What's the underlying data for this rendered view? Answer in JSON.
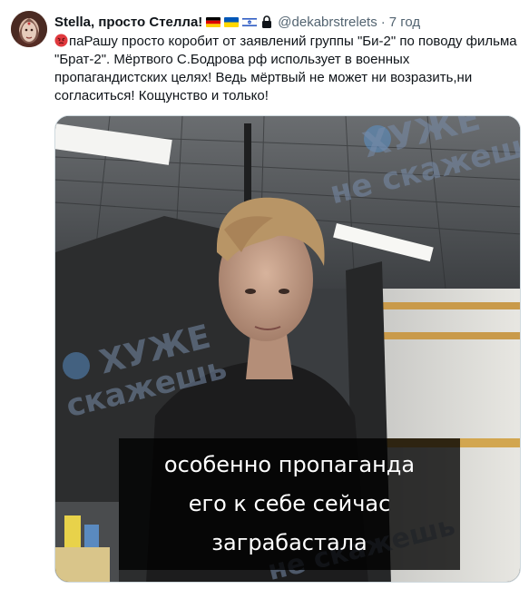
{
  "tweet": {
    "display_name": "Stella, просто Стелла!",
    "handle": "@dekabrstrelets",
    "separator": "·",
    "time": "7 год",
    "flags": [
      "flag-germany",
      "flag-ukraine",
      "flag-israel"
    ],
    "text_after_emoji": "паРашу просто коробит от заявлений группы \"Би-2\" по поводу фильма \"Брат-2\". Мёртвого С.Бодрова рф использует в военных пропагандистских целях! Ведь мёртвый не может ни возразить,ни согласиться! Кощунство и только!"
  },
  "media": {
    "subtitle_lines": [
      "особенно пропаганда",
      "его к себе сейчас",
      "заграбастала"
    ],
    "watermark": {
      "line1": "ХУЖЕ",
      "line2": "не скажешь",
      "line2_alt": "скажешь"
    }
  },
  "colors": {
    "text": "#0f1419",
    "secondary": "#536471",
    "border": "#cfd9de"
  }
}
